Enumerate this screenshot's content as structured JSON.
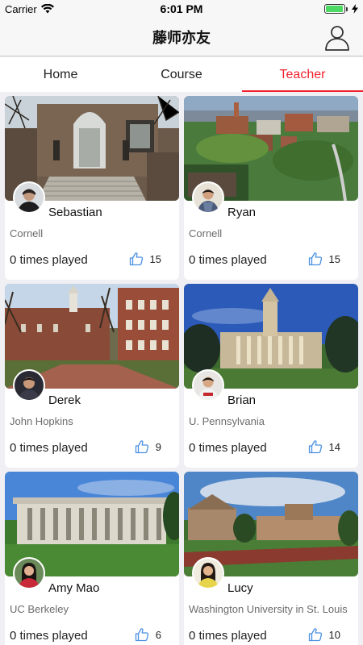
{
  "status_bar": {
    "carrier": "Carrier",
    "time": "6:01 PM",
    "battery_level": 0.95
  },
  "header": {
    "title": "藤师亦友",
    "profile_icon": "person-outline-icon"
  },
  "tabs": [
    {
      "label": "Home",
      "active": false
    },
    {
      "label": "Course",
      "active": false
    },
    {
      "label": "Teacher",
      "active": true
    }
  ],
  "colors": {
    "accent": "#f2212c",
    "like_icon": "#4a90e2",
    "background": "#efeff4"
  },
  "teachers": [
    {
      "name": "Sebastian",
      "school": "Cornell",
      "plays": "0 times played",
      "likes": "15"
    },
    {
      "name": "Ryan",
      "school": "Cornell",
      "plays": "0 times played",
      "likes": "15"
    },
    {
      "name": "Derek",
      "school": "John Hopkins",
      "plays": "0 times played",
      "likes": "9"
    },
    {
      "name": "Brian",
      "school": "U. Pennsylvania",
      "plays": "0 times played",
      "likes": "14"
    },
    {
      "name": "Amy Mao",
      "school": "UC Berkeley",
      "plays": "0 times played",
      "likes": "6"
    },
    {
      "name": "Lucy",
      "school": "Washington University in St. Louis",
      "plays": "0 times played",
      "likes": "10"
    }
  ]
}
